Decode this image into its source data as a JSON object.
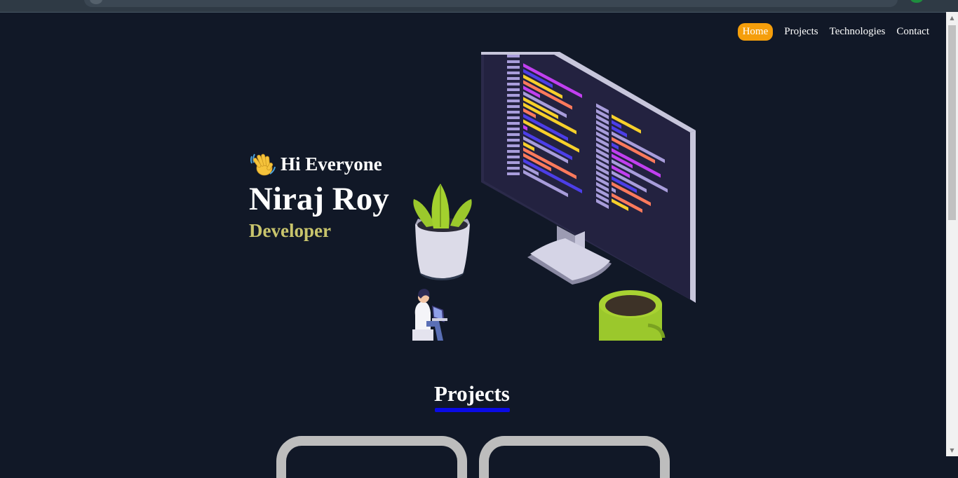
{
  "nav": {
    "items": [
      {
        "label": "Home",
        "active": true
      },
      {
        "label": "Projects",
        "active": false
      },
      {
        "label": "Technologies",
        "active": false
      },
      {
        "label": "Contact",
        "active": false
      }
    ],
    "active_color": "#f59e0b"
  },
  "hero": {
    "greeting": "Hi Everyone",
    "name": "Niraj Roy",
    "role": "Developer",
    "wave_icon": "waving-hand-icon",
    "illustration": "developer-desk-illustration"
  },
  "projects": {
    "title": "Projects",
    "underline_color": "#0a0ae6"
  },
  "colors": {
    "background": "#111827",
    "role_text": "#c8c46c"
  }
}
